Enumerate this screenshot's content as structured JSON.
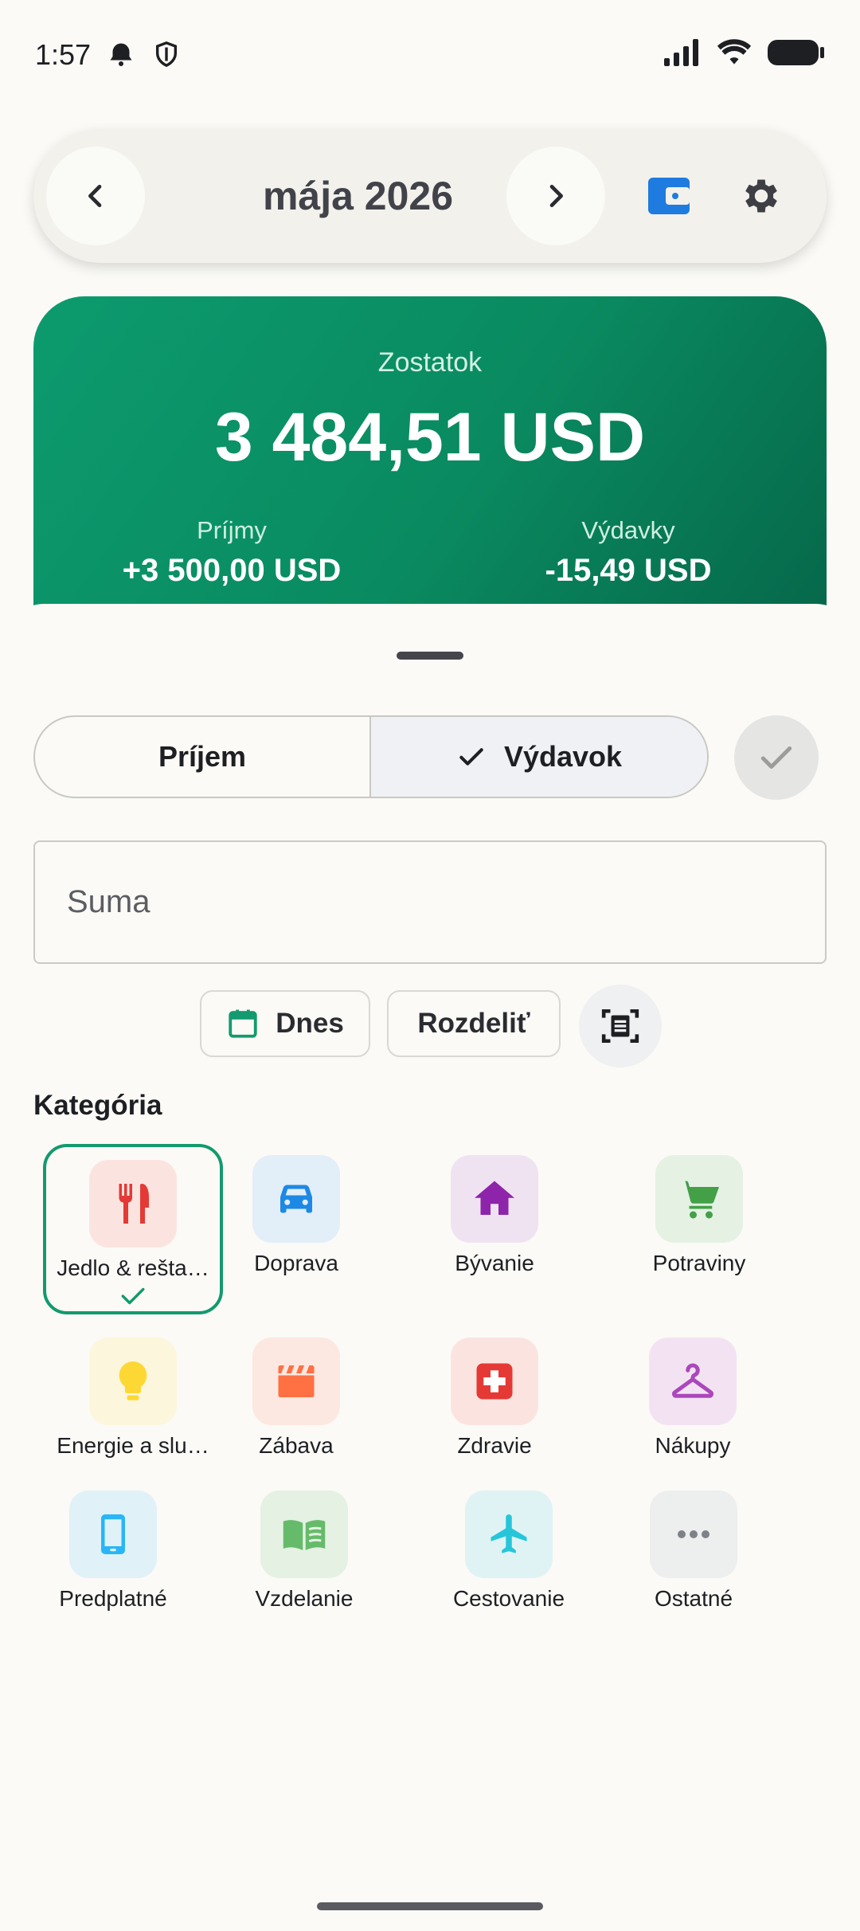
{
  "status_bar": {
    "time": "1:57"
  },
  "header": {
    "month_title": "mája 2026"
  },
  "balance": {
    "label": "Zostatok",
    "value": "3 484,51 USD",
    "income_label": "Príjmy",
    "income_value": "+3 500,00 USD",
    "expense_label": "Výdavky",
    "expense_value": "-15,49 USD"
  },
  "form": {
    "type_income": "Príjem",
    "type_expense": "Výdavok",
    "amount_placeholder": "Suma",
    "date_chip": "Dnes",
    "split_chip": "Rozdeliť",
    "category_heading": "Kategória"
  },
  "categories": [
    {
      "label": "Jedlo & rešta…",
      "icon": "restaurant-icon",
      "color": "#E53935",
      "bg": "#FBE4E0",
      "selected": true
    },
    {
      "label": "Doprava",
      "icon": "car-icon",
      "color": "#1E88E5",
      "bg": "#E2EEF8"
    },
    {
      "label": "Bývanie",
      "icon": "home-icon",
      "color": "#8E24AA",
      "bg": "#EFE3F2"
    },
    {
      "label": "Potraviny",
      "icon": "cart-icon",
      "color": "#43A047",
      "bg": "#E4F1E3"
    },
    {
      "label": "Energie a slu…",
      "icon": "lightbulb-icon",
      "color": "#FDD835",
      "bg": "#FCF6DC"
    },
    {
      "label": "Zábava",
      "icon": "clapperboard-icon",
      "color": "#FF7043",
      "bg": "#FCE8E0"
    },
    {
      "label": "Zdravie",
      "icon": "medical-icon",
      "color": "#E53935",
      "bg": "#FBE4E0"
    },
    {
      "label": "Nákupy",
      "icon": "hanger-icon",
      "color": "#AB47BC",
      "bg": "#F3E3F2"
    },
    {
      "label": "Predplatné",
      "icon": "phone-icon",
      "color": "#29B6F6",
      "bg": "#E0F2F8"
    },
    {
      "label": "Vzdelanie",
      "icon": "book-icon",
      "color": "#66BB6A",
      "bg": "#E4F1E3"
    },
    {
      "label": "Cestovanie",
      "icon": "airplane-icon",
      "color": "#26C6DA",
      "bg": "#DFF3F4"
    },
    {
      "label": "Ostatné",
      "icon": "more-icon",
      "color": "#7D8288",
      "bg": "#EDEEEE"
    }
  ],
  "colors": {
    "accent_green": "#0C9B6E",
    "wallet_blue": "#1E7BE0",
    "selected_border": "#139A6E"
  }
}
